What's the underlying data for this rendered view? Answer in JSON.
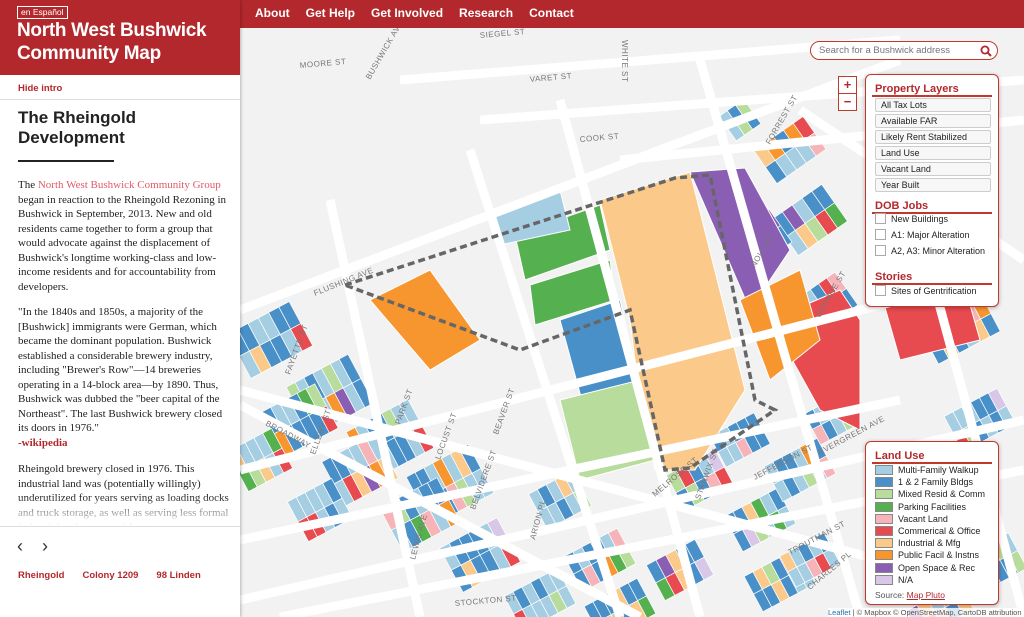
{
  "nav": {
    "items": [
      "About",
      "Get Help",
      "Get Involved",
      "Research",
      "Contact"
    ]
  },
  "sidebar": {
    "lang_label": "en Español",
    "site_title": "North West Bushwick Community Map",
    "hide_intro": "Hide intro",
    "story_title": "The Rheingold Development",
    "para1_pre": "The ",
    "para1_link": "North West Bushwick Community Group",
    "para1_post": " began in reaction to the Rheingold Rezoning in Bushwick in September, 2013. New and old residents came together to form a group that would advocate against the displacement of Bushwick's longtime working-class and low-income residents and for accountability from developers.",
    "para2": "\"In the 1840s and 1850s, a majority of the [Bushwick] immigrants were German, which became the dominant population. Bushwick established a considerable brewery industry, including \"Brewer's Row\"—14 breweries operating in a 14-block area—by 1890. Thus, Bushwick was dubbed the \"beer capital of the Northeast\". The last Bushwick brewery closed its doors in 1976.\"",
    "para2_link": "-wikipedia",
    "para3": "Rheingold brewery closed in 1976. This industrial land was (potentially willingly) underutilized for years serving as loading docks and truck storage, as well as serving less formal industrial and commercial uses.",
    "prev": "‹",
    "next": "›",
    "stories": [
      "Rheingold",
      "Colony 1209",
      "98 Linden"
    ]
  },
  "search": {
    "placeholder": "Search for a Bushwick address"
  },
  "zoom": {
    "in": "+",
    "out": "−"
  },
  "layers": {
    "property_title": "Property Layers",
    "property_items": [
      "All Tax Lots",
      "Available FAR",
      "Likely Rent Stabilized",
      "Land Use",
      "Vacant Land",
      "Year Built"
    ],
    "dob_title": "DOB Jobs",
    "dob_items": [
      "New Buildings",
      "A1: Major Alteration",
      "A2, A3: Minor Alteration"
    ],
    "stories_title": "Stories",
    "stories_items": [
      "Sites of Gentrification"
    ]
  },
  "legend": {
    "title": "Land Use",
    "items": [
      {
        "label": "Multi-Family Walkup",
        "color": "#a6cee3"
      },
      {
        "label": "1 & 2 Family Bldgs",
        "color": "#4a90c8"
      },
      {
        "label": "Mixed Resid & Comm",
        "color": "#b7dc9b"
      },
      {
        "label": "Parking Facilities",
        "color": "#55b14f"
      },
      {
        "label": "Vacant Land",
        "color": "#f6b3b8"
      },
      {
        "label": "Commerical & Office",
        "color": "#e74a4f"
      },
      {
        "label": "Industrial & Mfg",
        "color": "#fbc98a"
      },
      {
        "label": "Public Facil & Instns",
        "color": "#f7962f"
      },
      {
        "label": "Open Space & Rec",
        "color": "#8a5fb3"
      },
      {
        "label": "N/A",
        "color": "#d9c7e8"
      }
    ],
    "source_label": "Source:",
    "source_link": "Map Pluto"
  },
  "attribution": {
    "leaflet": "Leaflet",
    "text": " | © Mapbox © OpenStreetMap, CartoDB attribution"
  },
  "streets": [
    "BUSHWICK AVE",
    "MOORE ST",
    "SIEGEL ST",
    "VARET ST",
    "WHITE ST",
    "COOK ST",
    "FLUSHING AVE",
    "BROADWAY",
    "FORREST ST",
    "NOLL ST",
    "GEORGE ST",
    "MELROSE ST",
    "STANWIX ST",
    "JEFFERSON ST",
    "TROUTMAN ST",
    "EVERGREEN AVE",
    "CHARLES PL",
    "FAYETTE ST",
    "ELLERY ST",
    "PARK ST",
    "LOCUST ST",
    "BEAVER ST",
    "BELVIDERE ST",
    "ARION PL",
    "LEWIS AVE",
    "STOCKTON ST",
    "HARRISON PL"
  ]
}
